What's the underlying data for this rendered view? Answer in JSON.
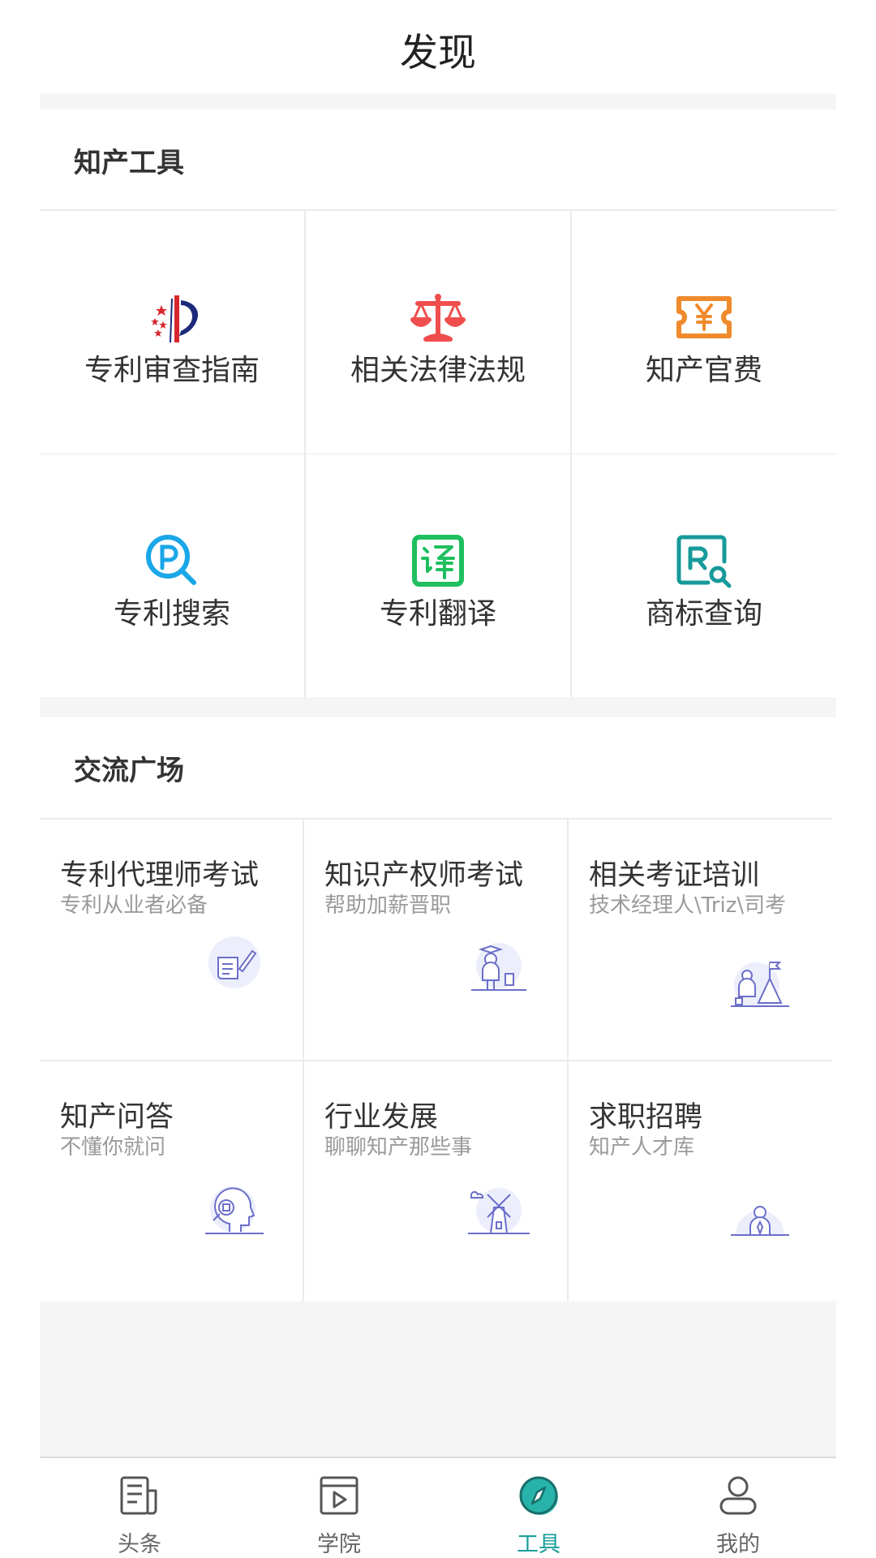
{
  "header": {
    "title": "发现"
  },
  "tools_section": {
    "title": "知产工具",
    "items": [
      {
        "label": "专利审查指南",
        "icon": "patent-office-logo-icon"
      },
      {
        "label": "相关法律法规",
        "icon": "scales-icon",
        "color": "#f04e4e"
      },
      {
        "label": "知产官费",
        "icon": "yen-ticket-icon",
        "color": "#f08a2b"
      },
      {
        "label": "专利搜索",
        "icon": "patent-search-icon",
        "color": "#1aa7e8"
      },
      {
        "label": "专利翻译",
        "icon": "translate-icon",
        "color": "#1fbf5f"
      },
      {
        "label": "商标查询",
        "icon": "trademark-search-icon",
        "color": "#169a9a"
      }
    ]
  },
  "forum_section": {
    "title": "交流广场",
    "items": [
      {
        "title": "专利代理师考试",
        "subtitle": "专利从业者必备",
        "icon": "scroll-pen-illustration"
      },
      {
        "title": "知识产权师考试",
        "subtitle": "帮助加薪晋职",
        "icon": "graduate-illustration"
      },
      {
        "title": "相关考证培训",
        "subtitle": "技术经理人\\Triz\\司考",
        "icon": "mountain-flag-illustration"
      },
      {
        "title": "知产问答",
        "subtitle": "不懂你就问",
        "icon": "head-magnifier-illustration"
      },
      {
        "title": "行业发展",
        "subtitle": "聊聊知产那些事",
        "icon": "windmill-illustration"
      },
      {
        "title": "求职招聘",
        "subtitle": "知产人才库",
        "icon": "person-tie-illustration"
      }
    ]
  },
  "tabbar": {
    "accent": "#1a9e9a",
    "items": [
      {
        "label": "头条",
        "icon": "newspaper-icon"
      },
      {
        "label": "学院",
        "icon": "video-play-icon"
      },
      {
        "label": "工具",
        "icon": "compass-icon",
        "active": true
      },
      {
        "label": "我的",
        "icon": "person-icon"
      }
    ]
  }
}
